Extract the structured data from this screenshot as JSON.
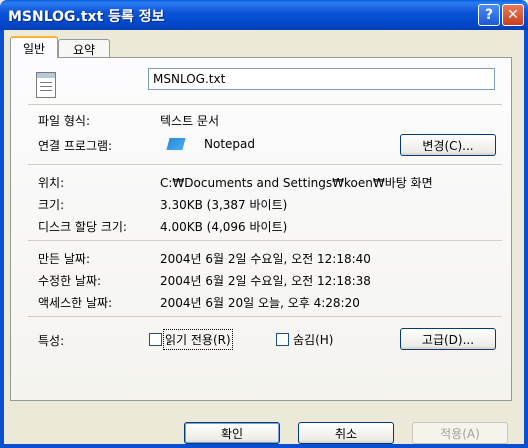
{
  "window": {
    "title": "MSNLOG.txt 등록 정보",
    "help_glyph": "?",
    "close_glyph": "✕"
  },
  "tabs": [
    {
      "label": "일반"
    },
    {
      "label": "요약"
    }
  ],
  "file": {
    "name": "MSNLOG.txt",
    "icon": "text-file-icon"
  },
  "props": {
    "type_label": "파일 형식:",
    "type_value": "텍스트 문서",
    "opens_label": "연결 프로그램:",
    "opens_value": "Notepad",
    "opens_icon": "notepad-icon",
    "change_button": "변경(C)...",
    "location_label": "위치:",
    "location_value": "C:₩Documents and Settings₩koen₩바탕 화면",
    "size_label": "크기:",
    "size_value": "3.30KB (3,387 바이트)",
    "disk_label": "디스크 할당 크기:",
    "disk_value": "4.00KB (4,096 바이트)",
    "created_label": "만든 날짜:",
    "created_value": "2004년 6월 2일 수요일, 오전 12:18:40",
    "modified_label": "수정한 날짜:",
    "modified_value": "2004년 6월 2일 수요일, 오전 12:18:38",
    "accessed_label": "액세스한 날짜:",
    "accessed_value": "2004년 6월 20일 오늘, 오후 4:28:20",
    "attr_label": "특성:",
    "readonly_label": "읽기 전용(R)",
    "readonly_checked": false,
    "hidden_label": "숨김(H)",
    "hidden_checked": false,
    "advanced_button": "고급(D)..."
  },
  "footer": {
    "ok": "확인",
    "cancel": "취소",
    "apply": "적용(A)"
  }
}
